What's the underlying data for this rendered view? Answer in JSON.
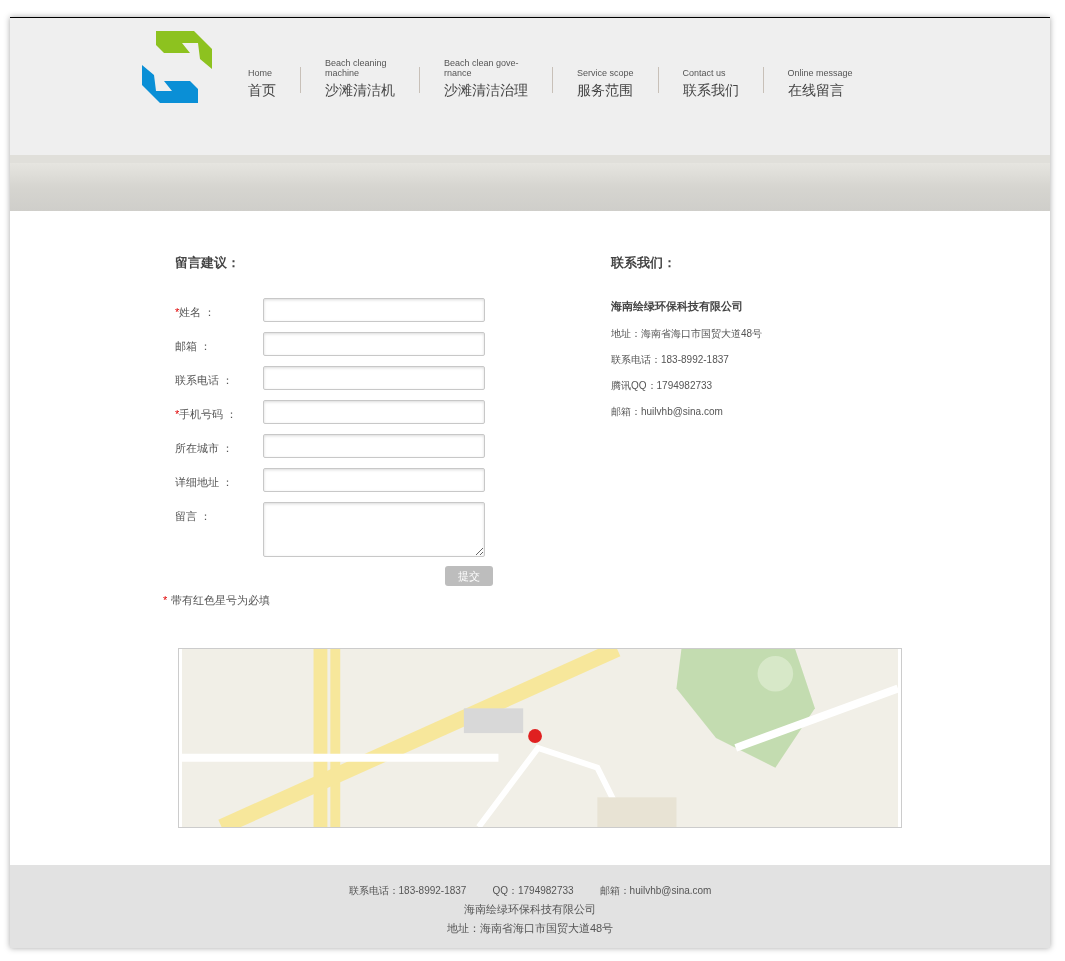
{
  "nav": [
    {
      "en": "Home",
      "zh": "首页"
    },
    {
      "en": "Beach cleaning\nmachine",
      "zh": "沙滩清洁机"
    },
    {
      "en": "Beach clean gove-\nrnance",
      "zh": "沙滩清洁治理"
    },
    {
      "en": "Service scope",
      "zh": "服务范围"
    },
    {
      "en": "Contact us",
      "zh": "联系我们"
    },
    {
      "en": "Online message",
      "zh": "在线留言"
    }
  ],
  "form": {
    "title": "留言建议：",
    "fields": [
      {
        "label": "姓名 ：",
        "required": true,
        "kind": "input"
      },
      {
        "label": "邮箱 ：",
        "required": false,
        "kind": "input"
      },
      {
        "label": "联系电话 ：",
        "required": false,
        "kind": "input"
      },
      {
        "label": "手机号码 ：",
        "required": true,
        "kind": "input"
      },
      {
        "label": "所在城市 ：",
        "required": false,
        "kind": "input"
      },
      {
        "label": "详细地址 ：",
        "required": false,
        "kind": "input"
      },
      {
        "label": "留言 ：",
        "required": false,
        "kind": "textarea"
      }
    ],
    "submit": "提交",
    "required_mark": "*",
    "note_mark": "*",
    "note": "带有红色星号为必填"
  },
  "contact": {
    "title": "联系我们：",
    "company": "海南绘绿环保科技有限公司",
    "lines": [
      "地址：海南省海口市国贸大道48号",
      "联系电话：183-8992-1837",
      "腾讯QQ：1794982733",
      "邮箱：huilvhb@sina.com"
    ]
  },
  "footer": {
    "items": [
      "联系电话：183-8992-1837",
      "QQ：1794982733",
      "邮箱：huilvhb@sina.com"
    ],
    "company": "海南绘绿环保科技有限公司",
    "address": "地址：海南省海口市国贸大道48号"
  }
}
